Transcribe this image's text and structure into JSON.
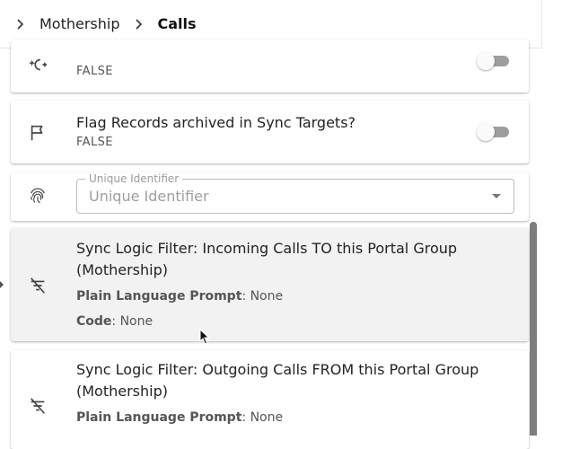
{
  "breadcrumb": {
    "items": [
      {
        "label": "Mothership"
      },
      {
        "label": "Calls"
      }
    ]
  },
  "settings": [
    {
      "icon": "sync-sparkle-icon",
      "title": "",
      "value": "FALSE",
      "enabled": false
    },
    {
      "icon": "flag-icon",
      "title": "Flag Records archived in Sync Targets?",
      "value": "FALSE",
      "enabled": false
    }
  ],
  "unique_identifier": {
    "icon": "fingerprint-icon",
    "label": "Unique Identifier",
    "placeholder": "Unique Identifier"
  },
  "filters": [
    {
      "icon": "filter-off-icon",
      "title": "Sync Logic Filter: Incoming Calls TO this Portal Group (Mothership)",
      "prompt_label": "Plain Language Prompt",
      "prompt_value": ": None",
      "code_label": "Code",
      "code_value": ": None"
    },
    {
      "icon": "filter-off-icon",
      "title": "Sync Logic Filter: Outgoing Calls FROM this Portal Group (Mothership)",
      "prompt_label": "Plain Language Prompt",
      "prompt_value": ": None"
    }
  ],
  "colors": {
    "selected_card": "#f2f2f2",
    "toggle_off_track": "#9e9e9e",
    "scrollbar": "#7d7d7d"
  }
}
